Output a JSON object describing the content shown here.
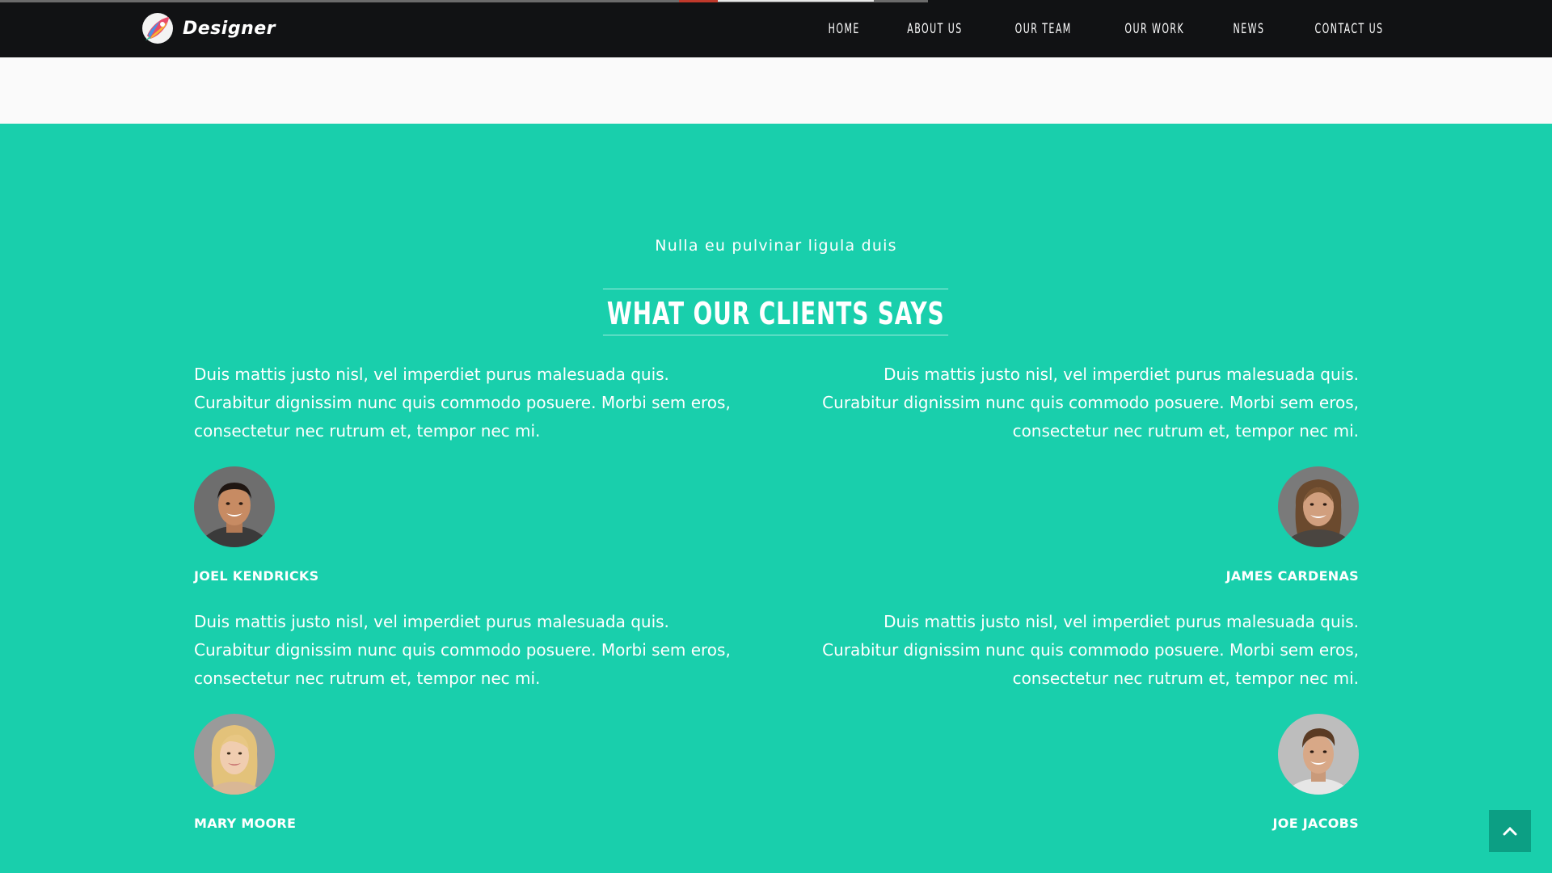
{
  "header": {
    "brand": "Designer",
    "nav": [
      "HOME",
      "ABOUT US",
      "OUR TEAM",
      "OUR WORK",
      "NEWS",
      "CONTACT US"
    ]
  },
  "testimonials": {
    "subtitle": "Nulla eu pulvinar ligula duis",
    "title": "WHAT OUR CLIENTS SAYS",
    "items": [
      {
        "quote": "Duis mattis justo nisl, vel imperdiet purus malesuada quis. Curabitur dignissim nunc quis commodo posuere. Morbi sem eros, consectetur nec rutrum et, tempor nec mi.",
        "name": "JOEL KENDRICKS"
      },
      {
        "quote": "Duis mattis justo nisl, vel imperdiet purus malesuada quis. Curabitur dignissim nunc quis commodo posuere. Morbi sem eros, consectetur nec rutrum et, tempor nec mi.",
        "name": "JAMES CARDENAS"
      },
      {
        "quote": "Duis mattis justo nisl, vel imperdiet purus malesuada quis. Curabitur dignissim nunc quis commodo posuere. Morbi sem eros, consectetur nec rutrum et, tempor nec mi.",
        "name": "MARY MOORE"
      },
      {
        "quote": "Duis mattis justo nisl, vel imperdiet purus malesuada quis. Curabitur dignissim nunc quis commodo posuere. Morbi sem eros, consectetur nec rutrum et, tempor nec mi.",
        "name": "JOE JACOBS"
      }
    ]
  },
  "colors": {
    "navbar_bg": "#111214",
    "section_bg": "#19cfac",
    "back_to_top_bg": "#0c9f84",
    "text": "#ffffff"
  },
  "icons": {
    "brand": "rocket-logo-icon",
    "back_to_top": "chevron-up-icon"
  }
}
